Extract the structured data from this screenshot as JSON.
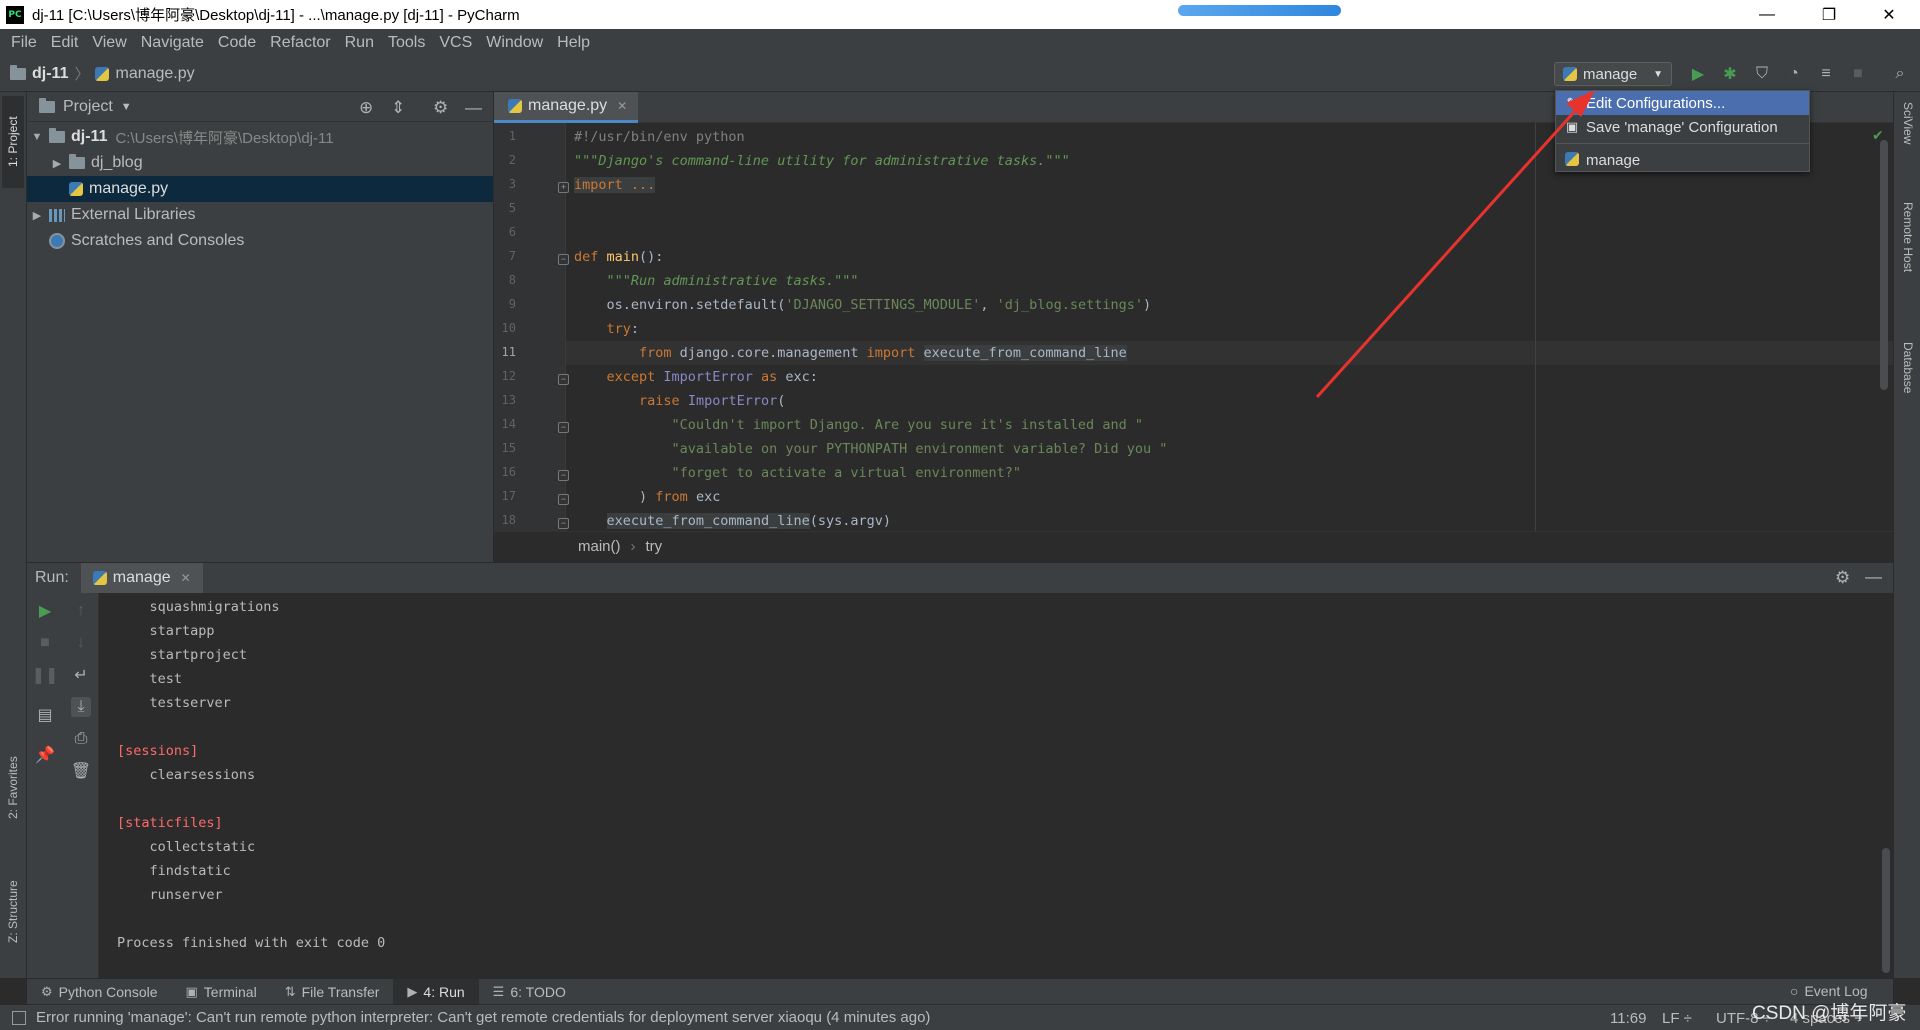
{
  "window": {
    "title": "dj-11 [C:\\Users\\博年阿豪\\Desktop\\dj-11] - ...\\manage.py [dj-11] - PyCharm",
    "app_icon": "PC",
    "minimize": "—",
    "restore": "❐",
    "close": "✕"
  },
  "menu": [
    "File",
    "Edit",
    "View",
    "Navigate",
    "Code",
    "Refactor",
    "Run",
    "Tools",
    "VCS",
    "Window",
    "Help"
  ],
  "navbar": {
    "project": "dj-11",
    "file": "manage.py"
  },
  "run_config": {
    "selected": "manage"
  },
  "run_config_menu": {
    "items": [
      "Edit Configurations...",
      "Save 'manage' Configuration",
      "manage"
    ],
    "highlighted": "Edit Configurations..."
  },
  "left_stripe": {
    "project_tab": "1: Project",
    "favorites_tab": "2: Favorites",
    "structure_tab": "Z: Structure"
  },
  "right_stripe": {
    "sciview_tab": "SciView",
    "remote_host_tab": "Remote Host",
    "database_tab": "Database"
  },
  "project_panel": {
    "title": "Project",
    "tree": [
      {
        "label": "dj-11",
        "path": "C:\\Users\\博年阿豪\\Desktop\\dj-11",
        "expanded": true,
        "icon": "folder-icon"
      },
      {
        "label": "dj_blog",
        "expanded": false,
        "icon": "folder-icon"
      },
      {
        "label": "manage.py",
        "selected": true,
        "icon": "python-file-icon"
      },
      {
        "label": "External Libraries",
        "expanded": false,
        "icon": "library-icon"
      },
      {
        "label": "Scratches and Consoles",
        "icon": "scratches-icon"
      }
    ]
  },
  "editor": {
    "tab": "manage.py",
    "current_line": 11,
    "line_numbers": [
      "1",
      "2",
      "3",
      "5",
      "6",
      "7",
      "8",
      "9",
      "10",
      "11",
      "12",
      "13",
      "14",
      "15",
      "16",
      "17",
      "18"
    ],
    "lines": {
      "l1": "#!/usr/bin/env python",
      "l2": "\"\"\"Django's command-line utility for administrative tasks.\"\"\"",
      "l3": "import ...",
      "l7_kw": "def ",
      "l7_fn": "main",
      "l7_rest": "():",
      "l8": "\"\"\"Run administrative tasks.\"\"\"",
      "l9_a": "os.environ.setdefault(",
      "l9_s1": "'DJANGO_SETTINGS_MODULE'",
      "l9_b": ", ",
      "l9_s2": "'dj_blog.settings'",
      "l9_c": ")",
      "l10": "try",
      "l10_rest": ":",
      "l11_kw1": "from ",
      "l11_mod": "django.core.management ",
      "l11_kw2": "import ",
      "l11_name": "execute_from_command_line",
      "l12_kw": "except ",
      "l12_cls": "ImportError ",
      "l12_kw2": "as ",
      "l12_rest": "exc:",
      "l13_kw": "raise ",
      "l13_cls": "ImportError",
      "l13_rest": "(",
      "l14": "\"Couldn't import Django. Are you sure it's installed and \"",
      "l15": "\"available on your PYTHONPATH environment variable? Did you \"",
      "l16": "\"forget to activate a virtual environment?\"",
      "l17_a": ") ",
      "l17_kw": "from ",
      "l17_b": "exc",
      "l18_name": "execute_from_command_line",
      "l18_rest": "(sys.argv)"
    },
    "breadcrumb": [
      "main()",
      "try"
    ]
  },
  "run_window": {
    "label": "Run:",
    "tab": "manage",
    "output": [
      {
        "text": "    squashmigrations",
        "type": "normal"
      },
      {
        "text": "    startapp",
        "type": "normal"
      },
      {
        "text": "    startproject",
        "type": "normal"
      },
      {
        "text": "    test",
        "type": "normal"
      },
      {
        "text": "    testserver",
        "type": "normal"
      },
      {
        "text": "",
        "type": "normal"
      },
      {
        "text": "[sessions]",
        "type": "section"
      },
      {
        "text": "    clearsessions",
        "type": "normal"
      },
      {
        "text": "",
        "type": "normal"
      },
      {
        "text": "[staticfiles]",
        "type": "section"
      },
      {
        "text": "    collectstatic",
        "type": "normal"
      },
      {
        "text": "    findstatic",
        "type": "normal"
      },
      {
        "text": "    runserver",
        "type": "normal"
      },
      {
        "text": "",
        "type": "normal"
      },
      {
        "text": "Process finished with exit code 0",
        "type": "normal"
      }
    ]
  },
  "bottom_tabs": [
    {
      "label": "Python Console",
      "icon": "python-console-icon"
    },
    {
      "label": "Terminal",
      "icon": "terminal-icon"
    },
    {
      "label": "File Transfer",
      "icon": "file-transfer-icon"
    },
    {
      "label": "4: Run",
      "icon": "run-icon",
      "active": true
    },
    {
      "label": "6: TODO",
      "icon": "todo-icon"
    }
  ],
  "event_log": "Event Log",
  "status": {
    "message": "Error running 'manage': Can't run remote python interpreter: Can't get remote credentials for deployment server xiaoqu (4 minutes ago)",
    "position": "11:69",
    "line_sep": "LF ÷",
    "encoding": "UTF-8 ÷",
    "indent": "4 spaces ÷"
  },
  "watermark": "CSDN @博年阿豪",
  "colors": {
    "accent": "#4b6eaf",
    "arrow": "#e8332d",
    "run_green": "#499c54"
  }
}
